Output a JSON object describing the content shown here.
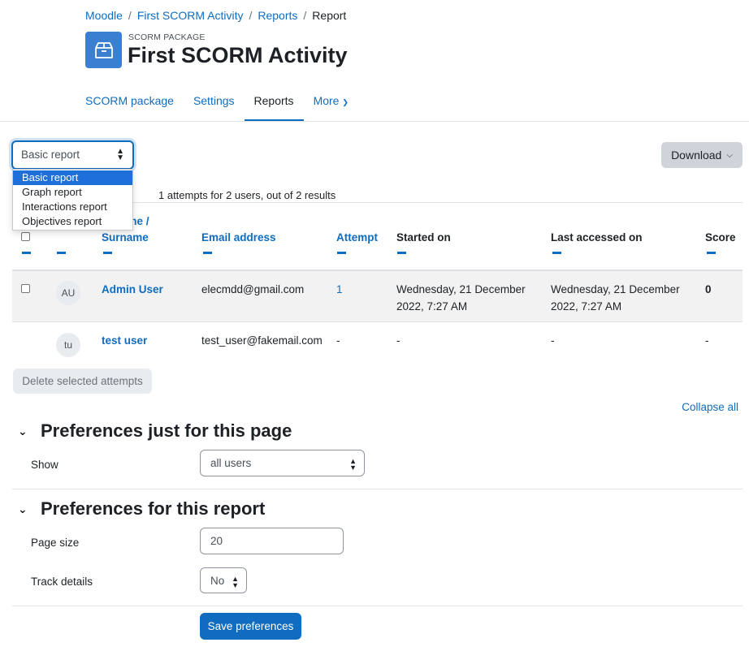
{
  "breadcrumb": {
    "items": [
      "Moodle",
      "First SCORM Activity",
      "Reports"
    ],
    "current": "Report",
    "separator": "/"
  },
  "header": {
    "package_label": "SCORM PACKAGE",
    "title": "First SCORM Activity",
    "icon": "package-icon"
  },
  "secondary_nav": {
    "tabs": [
      "SCORM package",
      "Settings",
      "Reports"
    ],
    "more": "More"
  },
  "report_select": {
    "value": "Basic report",
    "options": [
      "Basic report",
      "Graph report",
      "Interactions report",
      "Objectives report"
    ]
  },
  "download": {
    "label": "Download"
  },
  "summary": "1 attempts for 2 users, out of 2 results",
  "table": {
    "headers": {
      "first_name_partial": "ame /",
      "surname": "Surname",
      "email": "Email address",
      "attempt": "Attempt",
      "started": "Started on",
      "last_accessed": "Last accessed on",
      "score": "Score"
    },
    "rows": [
      {
        "initials": "AU",
        "name": "Admin User",
        "email": "elecmdd@gmail.com",
        "attempt": "1",
        "started_l1": "Wednesday, 21 December",
        "started_l2": "2022, 7:27 AM",
        "accessed_l1": "Wednesday, 21 December",
        "accessed_l2": "2022, 7:27 AM",
        "score": "0"
      },
      {
        "initials": "tu",
        "name": "test user",
        "email": "test_user@fakemail.com",
        "attempt": "-",
        "started": "-",
        "accessed": "-",
        "score": "-"
      }
    ]
  },
  "delete_button": "Delete selected attempts",
  "collapse_all": "Collapse all",
  "prefs_page": {
    "heading": "Preferences just for this page",
    "show_label": "Show",
    "show_value": "all users"
  },
  "prefs_report": {
    "heading": "Preferences for this report",
    "page_size_label": "Page size",
    "page_size_value": "20",
    "track_label": "Track details",
    "track_value": "No"
  },
  "save_button": "Save preferences",
  "colors": {
    "primary": "#0f6cbf",
    "activity_icon": "#3a7fd0",
    "selected_option": "#1e6fd9"
  }
}
